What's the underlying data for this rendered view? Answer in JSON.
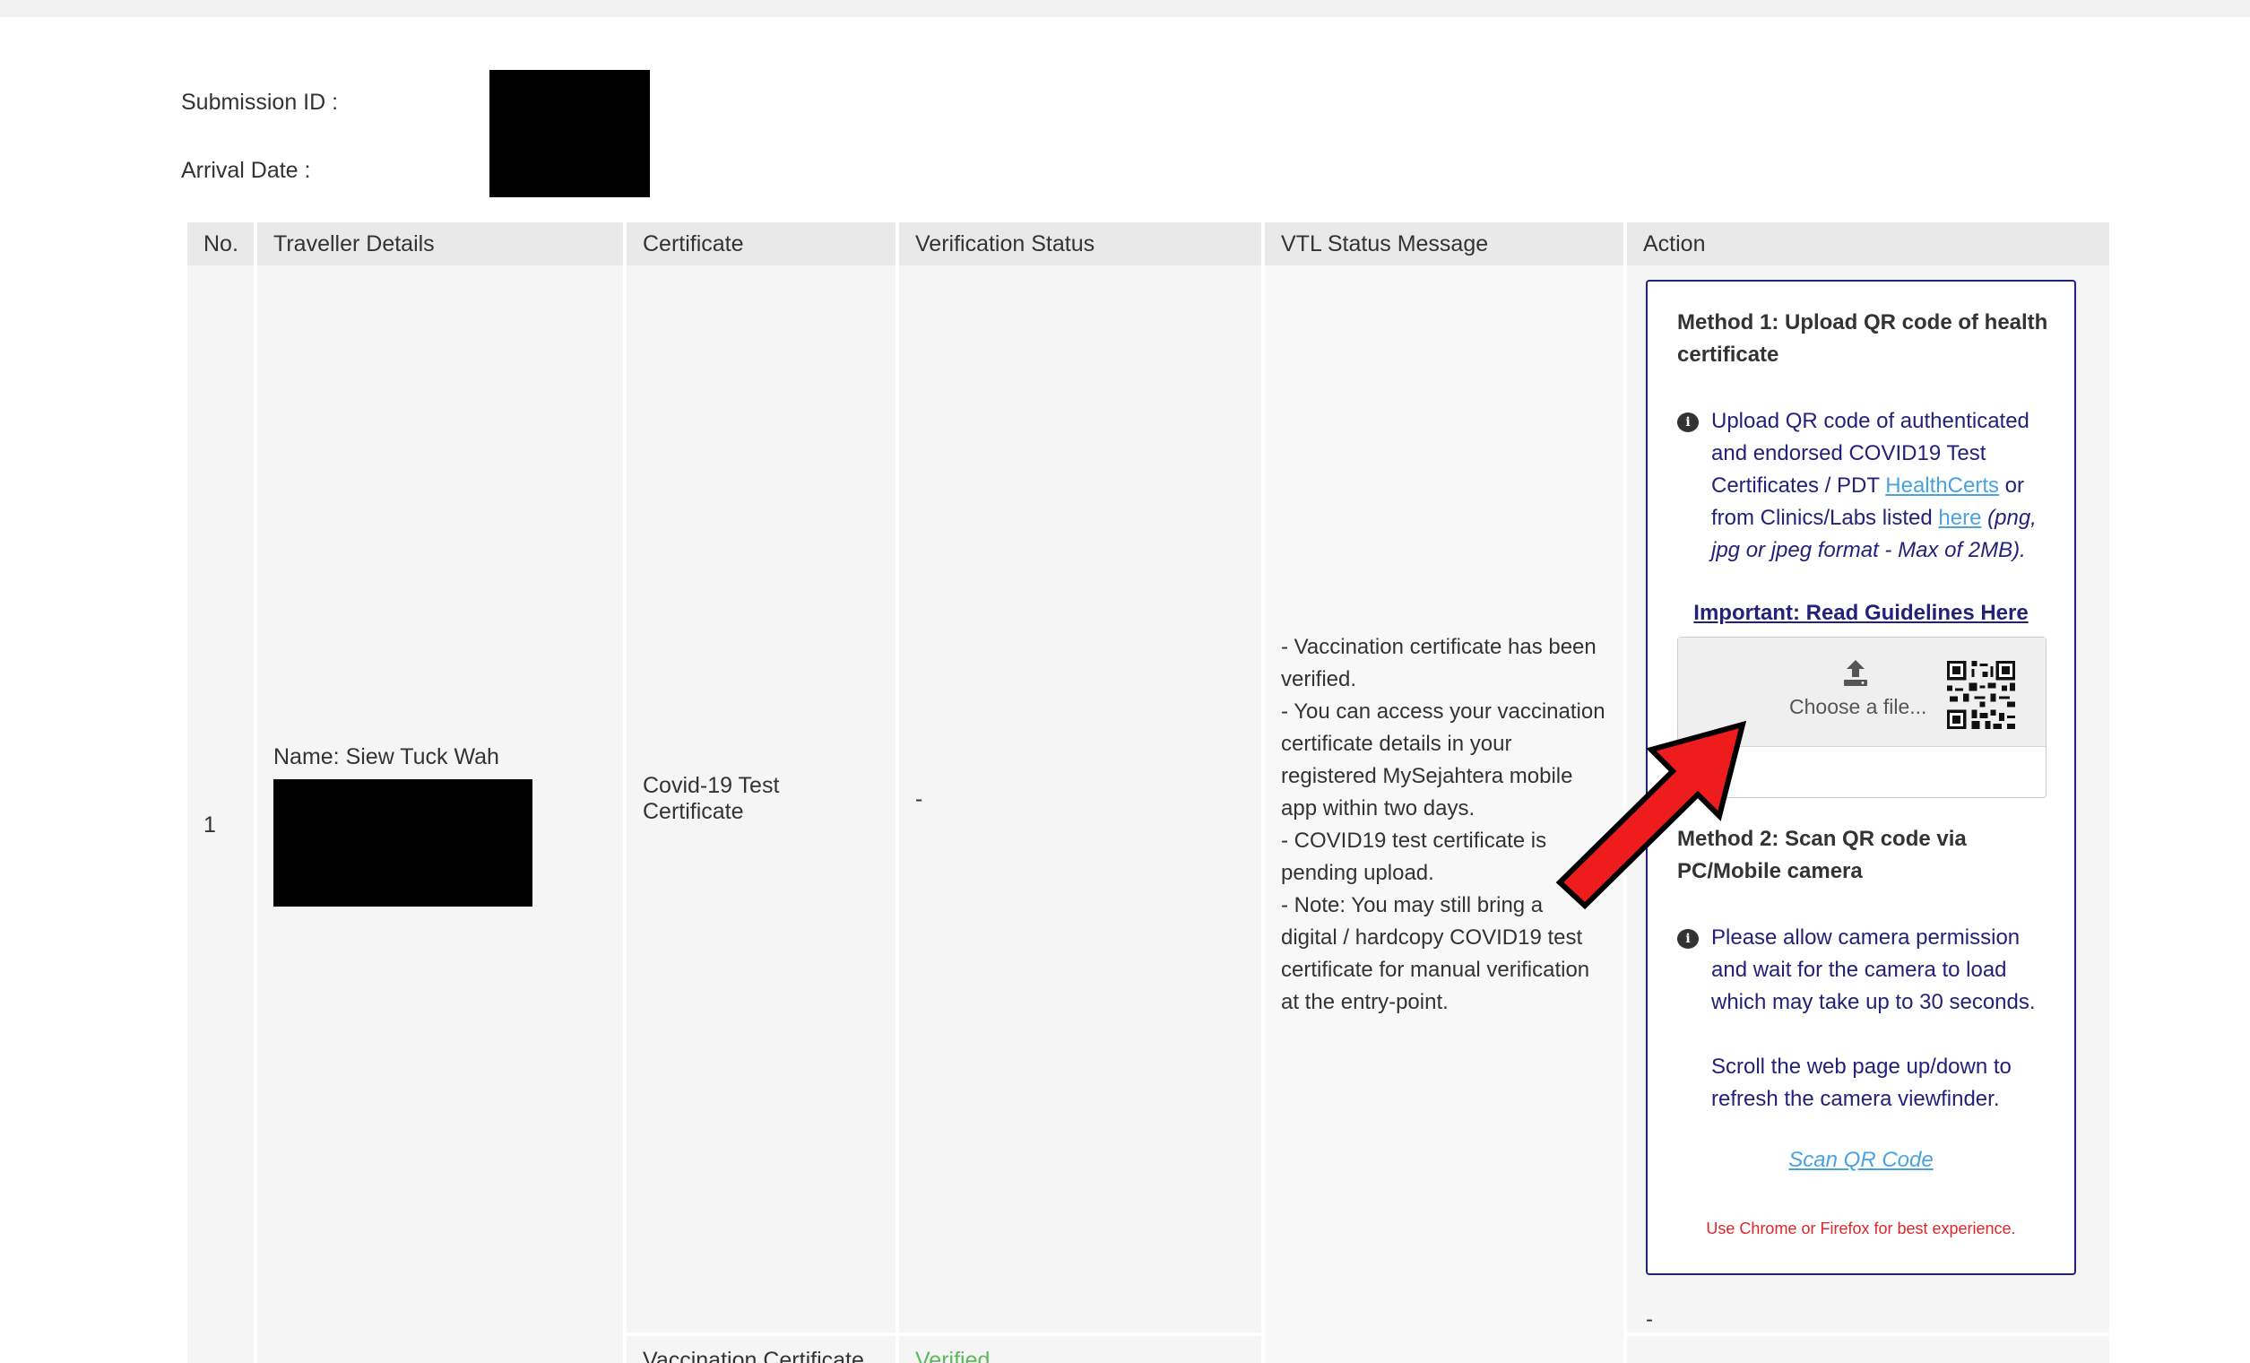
{
  "meta": {
    "submission_label": "Submission ID :",
    "arrival_label": "Arrival Date :"
  },
  "table": {
    "headers": [
      "No.",
      "Traveller Details",
      "Certificate",
      "Verification Status",
      "VTL Status Message",
      "Action"
    ],
    "row": {
      "number": "1",
      "traveller_name": "Name: Siew Tuck Wah",
      "certificate": "Covid-19 Test Certificate",
      "status": "-",
      "vtl_lines": [
        "- Vaccination certificate has been",
        "verified.",
        "- You can access your vaccination",
        "certificate details in your",
        "registered MySejahtera mobile",
        "app within two days.",
        "- COVID19 test certificate is",
        "pending upload.",
        "- Note: You may still bring a",
        "digital / hardcopy COVID19 test",
        "certificate for manual verification",
        "at the entry-point."
      ]
    },
    "vaccination_row": {
      "certificate": "Vaccination Certificate",
      "status": "Verified",
      "action": "-"
    }
  },
  "action": {
    "method1_title": "Method 1: Upload QR code of health certificate",
    "method1_info_prefix": "Upload QR code of authenticated and endorsed COVID19 Test Certificates / PDT ",
    "method1_link1": "HealthCerts",
    "method1_info_mid": " or from Clinics/Labs listed ",
    "method1_link2": "here",
    "method1_info_suffix": " (png, jpg or jpeg format - Max of 2MB).",
    "guidelines_link": "Important: Read Guidelines Here",
    "choose_file": "Choose a file...",
    "method2_title": "Method 2: Scan QR code via PC/Mobile camera",
    "method2_info": "Please allow camera permission and wait for the camera to load which may take up to 30 seconds.",
    "method2_scroll": "Scroll the web page up/down to refresh the camera viewfinder.",
    "scan_link": "Scan QR Code",
    "browser_note": "Use Chrome or Firefox for best experience."
  },
  "colors": {
    "navy": "#22227a",
    "link": "#4aa3df",
    "verified": "#5cb85c",
    "note_red": "#e0262b",
    "arrow_red": "#ee1c1c"
  }
}
